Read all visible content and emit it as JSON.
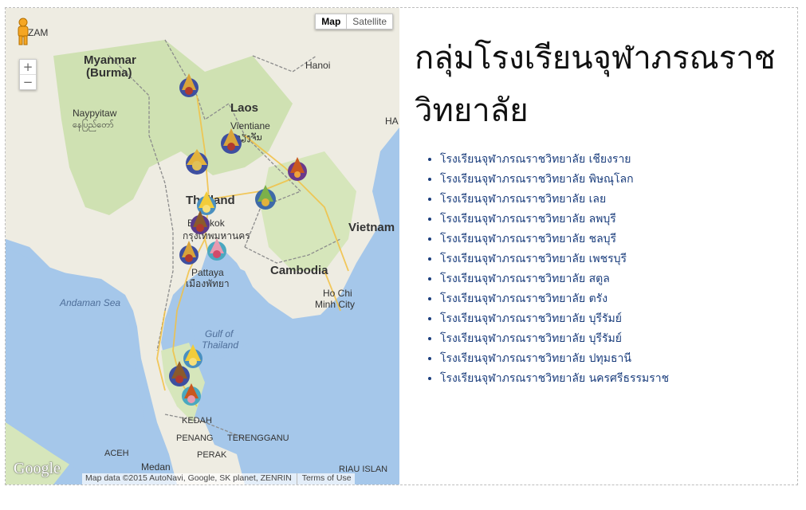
{
  "page": {
    "title": "กลุ่มโรงเรียนจุฬาภรณราชวิทยาลัย",
    "schools": [
      "โรงเรียนจุฬาภรณราชวิทยาลัย เชียงราย",
      "โรงเรียนจุฬาภรณราชวิทยาลัย พิษณุโลก",
      "โรงเรียนจุฬาภรณราชวิทยาลัย เลย",
      "โรงเรียนจุฬาภรณราชวิทยาลัย ลพบุรี",
      "โรงเรียนจุฬาภรณราชวิทยาลัย ชลบุรี",
      "โรงเรียนจุฬาภรณราชวิทยาลัย เพชรบุรี",
      "โรงเรียนจุฬาภรณราชวิทยาลัย สตูล",
      "โรงเรียนจุฬาภรณราชวิทยาลัย ตรัง",
      "โรงเรียนจุฬาภรณราชวิทยาลัย บุรีรัมย์",
      "โรงเรียนจุฬาภรณราชวิทยาลัย บุรีรัมย์",
      "โรงเรียนจุฬาภรณราชวิทยาลัย ปทุมธานี",
      "โรงเรียนจุฬาภรณราชวิทยาลัย นครศรีธรรมราช"
    ]
  },
  "map": {
    "type_control": {
      "map_label": "Map",
      "satellite_label": "Satellite"
    },
    "zoom": {
      "in": "+",
      "out": "−"
    },
    "logo": "Google",
    "attribution": "Map data ©2015 AutoNavi, Google, SK planet, ZENRIN",
    "terms": "Terms of Use",
    "labels": {
      "myanmar": "Myanmar",
      "burma": "(Burma)",
      "naypyitaw": "Naypyitaw",
      "naypyitaw_local": "နေပြည်တော်",
      "hanoi": "Hanoi",
      "laos": "Laos",
      "vientiane": "Vientiane",
      "vientiane_local": "ວຽງຈັນ",
      "thailand": "Thailand",
      "bangkok": "Bangkok",
      "bangkok_local": "กรุงเทพมหานคร",
      "vietnam": "Vietnam",
      "pattaya": "Pattaya",
      "pattaya_local": "เมืองพัทยา",
      "cambodia": "Cambodia",
      "andaman": "Andaman Sea",
      "hochiminh": "Ho Chi",
      "hochiminh2": "Minh City",
      "gulf": "Gulf of",
      "gulf2": "Thailand",
      "kedah": "KEDAH",
      "penang": "PENANG",
      "terengganu": "TERENGGANU",
      "perak": "PERAK",
      "aceh": "ACEH",
      "medan": "Medan",
      "riau": "RIAU ISLAN",
      "zam": "ZAM",
      "ha": "HA"
    },
    "colors": {
      "water": "#a5c7ea",
      "land": "#f0ede5",
      "forest": "#cddfb0",
      "border": "#8a8a8a"
    }
  }
}
